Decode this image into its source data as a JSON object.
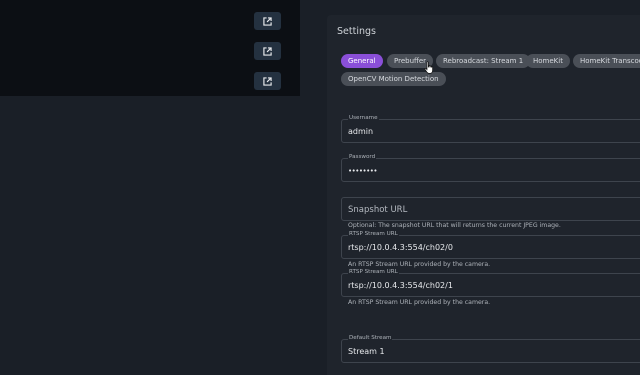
{
  "left_buttons": [
    "open-external-icon",
    "open-external-icon",
    "open-external-icon"
  ],
  "settings": {
    "title": "Settings",
    "tabs": [
      {
        "label": "General",
        "active": true
      },
      {
        "label": "Prebuffer",
        "active": false
      },
      {
        "label": "Rebroadcast: Stream 1",
        "active": false
      },
      {
        "label": "HomeKit",
        "active": false
      },
      {
        "label": "HomeKit Transcoding",
        "active": false
      },
      {
        "label": "OpenCV Motion Detection",
        "active": false
      }
    ],
    "fields": {
      "username": {
        "label": "Username",
        "value": "admin"
      },
      "password": {
        "label": "Password",
        "value": "••••••••"
      },
      "snapshot": {
        "placeholder": "Snapshot URL",
        "helper": "Optional: The snapshot URL that will returns the current JPEG image."
      },
      "rtsp1": {
        "label": "RTSP Stream URL",
        "value": "rtsp://10.0.4.3:554/ch02/0",
        "helper": "An RTSP Stream URL provided by the camera."
      },
      "rtsp2": {
        "label": "RTSP Stream URL",
        "value": "rtsp://10.0.4.3:554/ch02/1",
        "helper": "An RTSP Stream URL provided by the camera."
      },
      "default_stream": {
        "label": "Default Stream",
        "value": "Stream 1"
      }
    }
  },
  "colors": {
    "accent": "#8a4fd8",
    "chip": "#4a4f57",
    "panel": "#1f242c",
    "background": "#1a1f27"
  }
}
